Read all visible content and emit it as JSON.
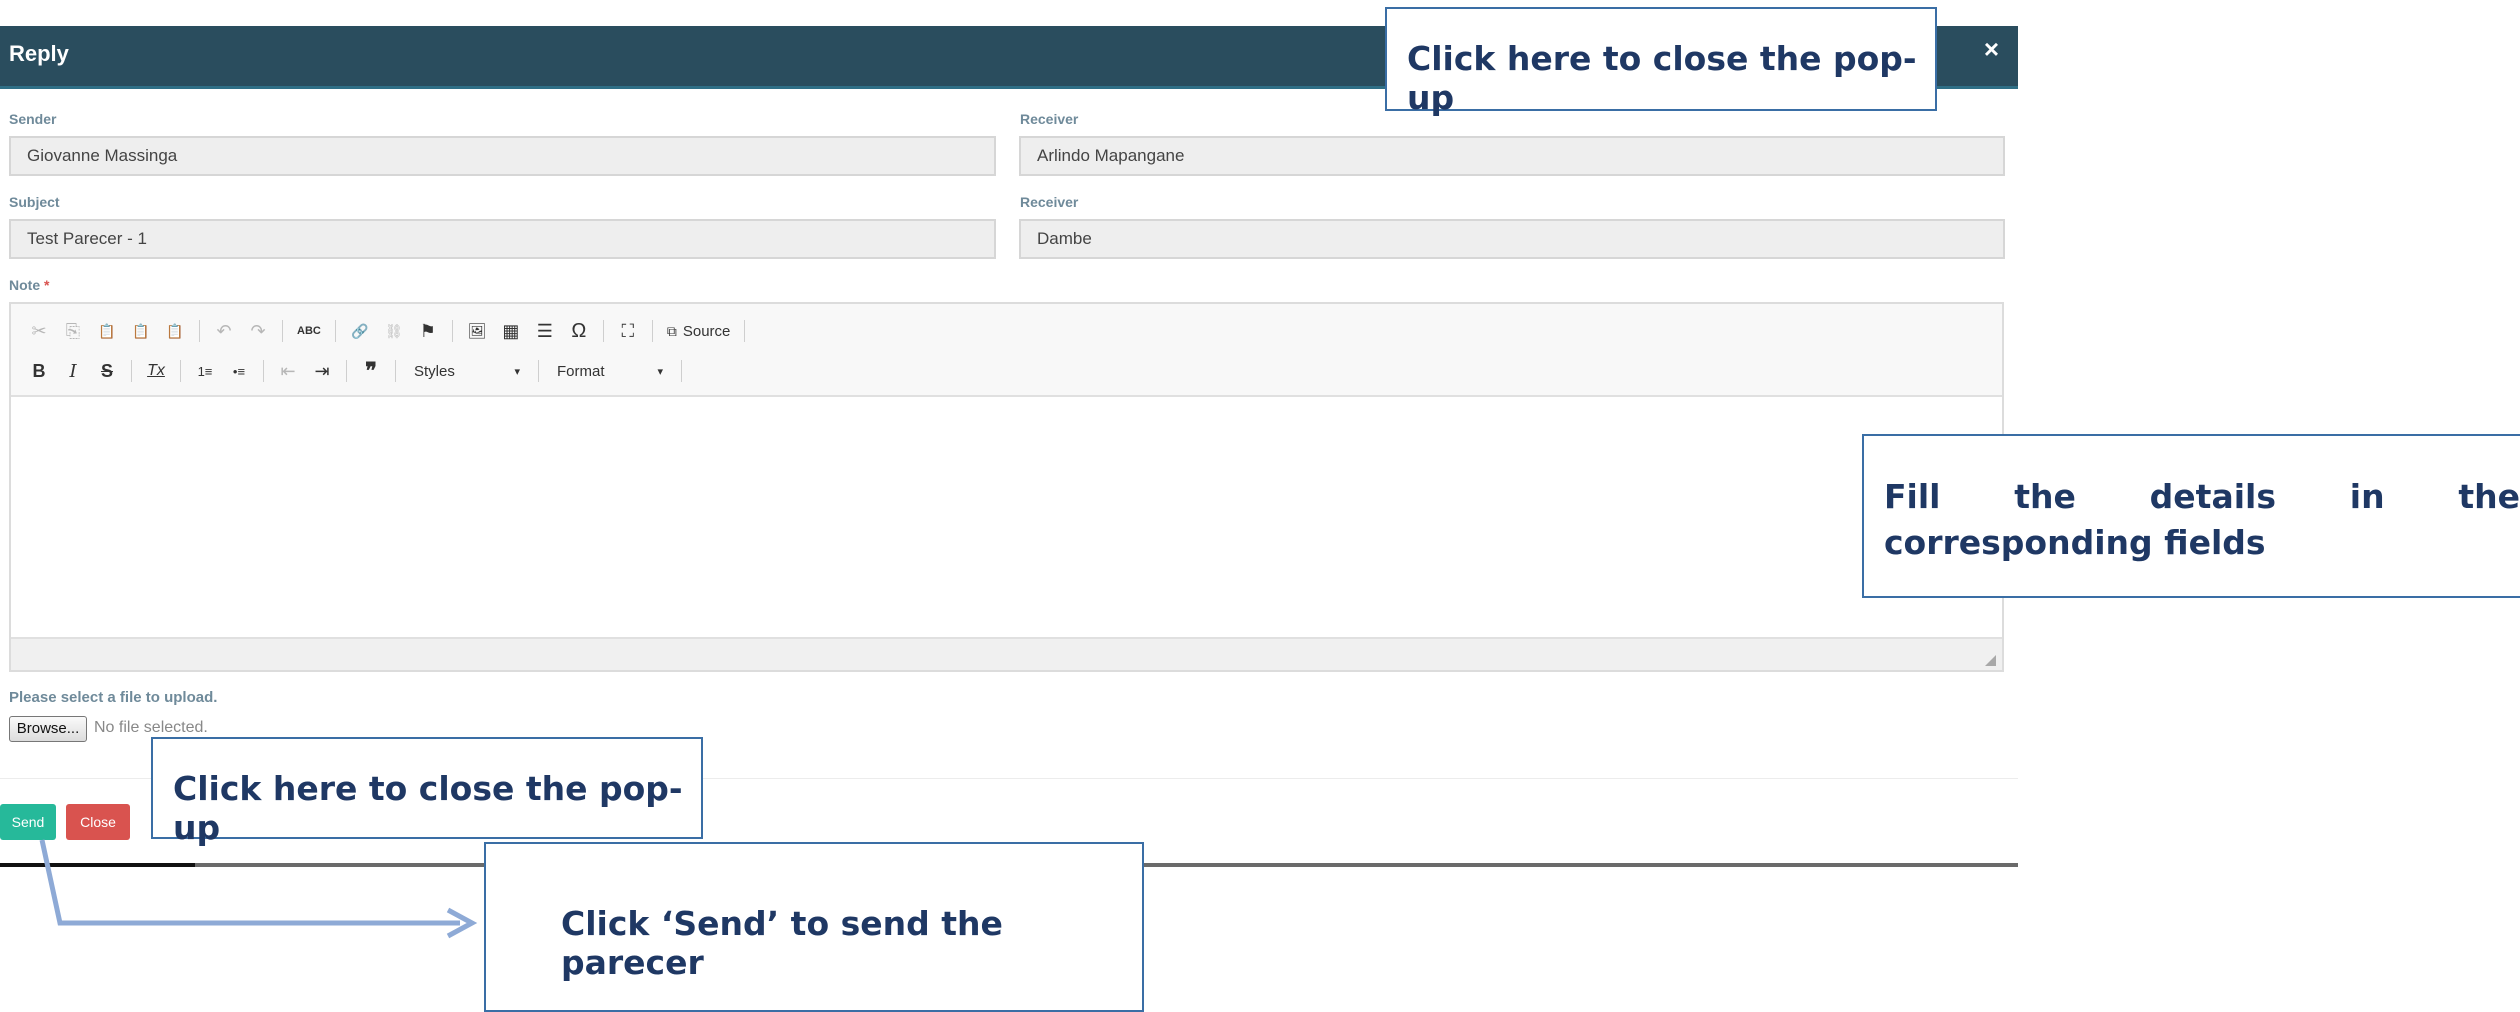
{
  "dialog": {
    "title": "Reply",
    "close_icon": "×"
  },
  "form": {
    "sender_label": "Sender",
    "sender_value": "Giovanne Massinga",
    "receiver_label": "Receiver",
    "receiver_value": "Arlindo Mapangane",
    "subject_label": "Subject",
    "subject_value": "Test Parecer - 1",
    "receiver2_label": "Receiver",
    "receiver2_value": "Dambe",
    "note_label": "Note",
    "note_required": "*"
  },
  "toolbar": {
    "row1": {
      "cut": "✂",
      "copy": "⎘",
      "paste": "📋",
      "paste_text": "📋",
      "paste_word": "📋",
      "undo": "↶",
      "redo": "↷",
      "spellcheck": "ABC",
      "link": "🔗",
      "unlink": "⛓",
      "anchor": "⚑",
      "image": "🖼",
      "table": "▦",
      "hr": "☰",
      "special_char": "Ω",
      "maximize": "⛶",
      "source_icon": "⧉",
      "source_label": "Source"
    },
    "row2": {
      "bold": "B",
      "italic": "I",
      "strike": "S",
      "remove_format": "Tx",
      "numbered_list": "1≡",
      "bulleted_list": "•≡",
      "outdent": "⇤",
      "indent": "⇥",
      "blockquote": "❞",
      "styles": "Styles",
      "format": "Format",
      "dropdown_arrow": "▾"
    }
  },
  "upload": {
    "label": "Please select a file to upload.",
    "browse_label": "Browse...",
    "status": "No file selected."
  },
  "actions": {
    "send": "Send",
    "close": "Close"
  },
  "callouts": {
    "close_top": "Click  here to close the pop-up",
    "fill_details": "Fill the details in the corresponding fields",
    "close_bottom": "Click  here to close the pop-up",
    "send": "Click ‘Send’ to send the parecer"
  }
}
